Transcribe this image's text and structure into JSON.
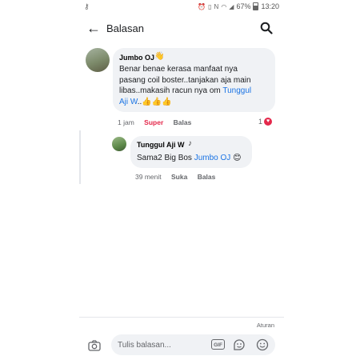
{
  "status_bar": {
    "battery": "67%",
    "time": "13:20"
  },
  "header": {
    "title": "Balasan"
  },
  "comment": {
    "author": "Jumbo OJ",
    "text_line1": "Benar benae kerasa manfaat nya",
    "text_line2": "pasang coil boster..tanjakan aja main",
    "text_line3": "libas..makasih racun nya om",
    "mention_part1": "Tunggul",
    "mention_part2": "Aji W",
    "text_tail": "..",
    "emojis": "👍👍👍",
    "time": "1 jam",
    "reaction_label": "Super",
    "reply_label": "Balas",
    "like_count": "1"
  },
  "reply": {
    "author": "Tunggul Aji W",
    "text": "Sama2 Big Bos",
    "mention": "Jumbo OJ",
    "emoji": "😊",
    "time": "39 menit",
    "like_label": "Suka",
    "reply_label": "Balas"
  },
  "footer": {
    "rules_label": "Aturan",
    "compose_placeholder": "Tulis balasan...",
    "gif_label": "GIF"
  },
  "colors": {
    "mention": "#1b74e4",
    "super_reaction": "#e4284b",
    "bubble_bg": "#f0f2f5",
    "secondary_text": "#65676b"
  },
  "icons": [
    "key-icon",
    "back-arrow-icon",
    "search-icon",
    "wave-icon",
    "heart-icon",
    "camera-icon",
    "gif-icon",
    "sticker-icon",
    "emoji-icon"
  ]
}
